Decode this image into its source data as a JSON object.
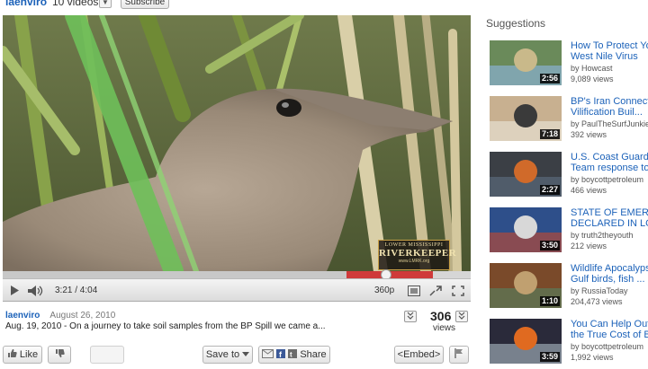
{
  "channel": {
    "name": "laenviro",
    "video_count": "10 videos",
    "subscribe_label": "Subscribe"
  },
  "player": {
    "time": "3:21 / 4:04",
    "quality": "360p",
    "progress": 0.82,
    "buffered": 0.92,
    "watermark": {
      "line1": "LOWER MISSISSIPPI",
      "line2": "RIVERKEEPER",
      "line3": "www.LMRK.org"
    }
  },
  "meta": {
    "uploader": "laenviro",
    "date": "August 26, 2010",
    "description": "Aug. 19, 2010 - On a journey to take soil samples from the BP Spill we came a...",
    "views_count": "306",
    "views_label": "views"
  },
  "actions": {
    "like": "Like",
    "save_to": "Save to",
    "share": "Share",
    "embed": "<Embed>"
  },
  "suggestions": {
    "header": "Suggestions",
    "items": [
      {
        "title1": "How To Protect Yo",
        "title2": "West Nile Virus",
        "by": "by Howcast",
        "views": "9,089 views",
        "duration": "2:56"
      },
      {
        "title1": "BP's Iran Connect",
        "title2": "Vilification Buil...",
        "by": "by PaulTheSurfJunkie",
        "views": "392 views",
        "duration": "7:18"
      },
      {
        "title1": "U.S. Coast Guard",
        "title2": "Team response to",
        "by": "by boycottpetroleum",
        "views": "466 views",
        "duration": "2:27"
      },
      {
        "title1": "STATE OF EMER",
        "title2": "DECLARED IN LO",
        "by": "by truth2theyouth",
        "views": "212 views",
        "duration": "3:50"
      },
      {
        "title1": "Wildlife Apocalyps",
        "title2": "Gulf birds, fish ...",
        "by": "by RussiaToday",
        "views": "204,473 views",
        "duration": "1:10"
      },
      {
        "title1": "You Can Help Out",
        "title2": "the True Cost of B",
        "by": "by boycottpetroleum",
        "views": "1,992 views",
        "duration": "3:59"
      }
    ]
  }
}
